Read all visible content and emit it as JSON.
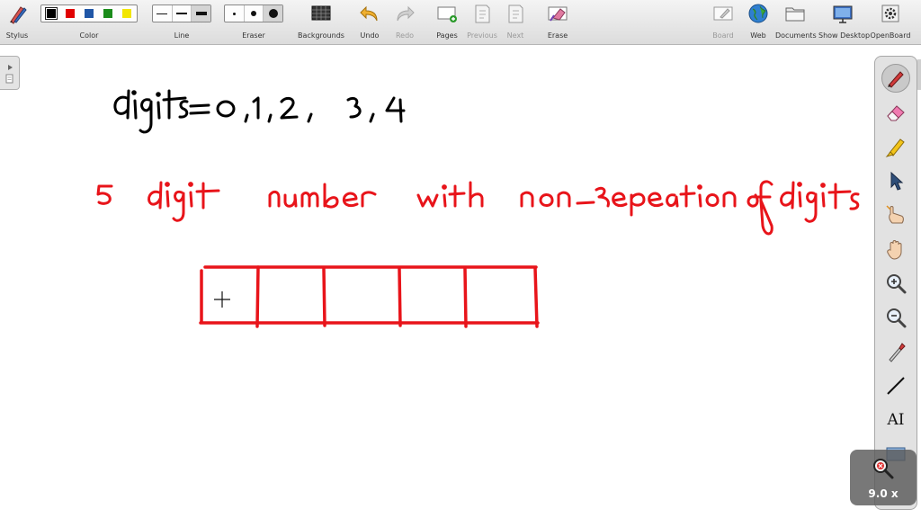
{
  "toolbar": {
    "stylus": "Stylus",
    "color": "Color",
    "line": "Line",
    "eraser": "Eraser",
    "backgrounds": "Backgrounds",
    "undo": "Undo",
    "redo": "Redo",
    "pages": "Pages",
    "previous": "Previous",
    "next": "Next",
    "erase": "Erase",
    "board": "Board",
    "web": "Web",
    "documents": "Documents",
    "show_desktop": "Show Desktop",
    "openboard": "OpenBoard"
  },
  "colors": {
    "swatches": [
      "#000000",
      "#e00000",
      "#1f56a6",
      "#1a8c1a",
      "#f2e600"
    ],
    "ink_black": "#000000",
    "ink_red": "#e8141a"
  },
  "palette": {
    "items": [
      "pen-icon",
      "eraser-icon",
      "highlighter-icon",
      "pointer-icon",
      "laser-hand-icon",
      "hand-icon",
      "zoom-in-icon",
      "zoom-out-icon",
      "pipette-icon",
      "line-icon",
      "text-icon",
      "capture-icon"
    ],
    "text_tool_label": "AI"
  },
  "zoom": {
    "label": "9.0 x"
  }
}
